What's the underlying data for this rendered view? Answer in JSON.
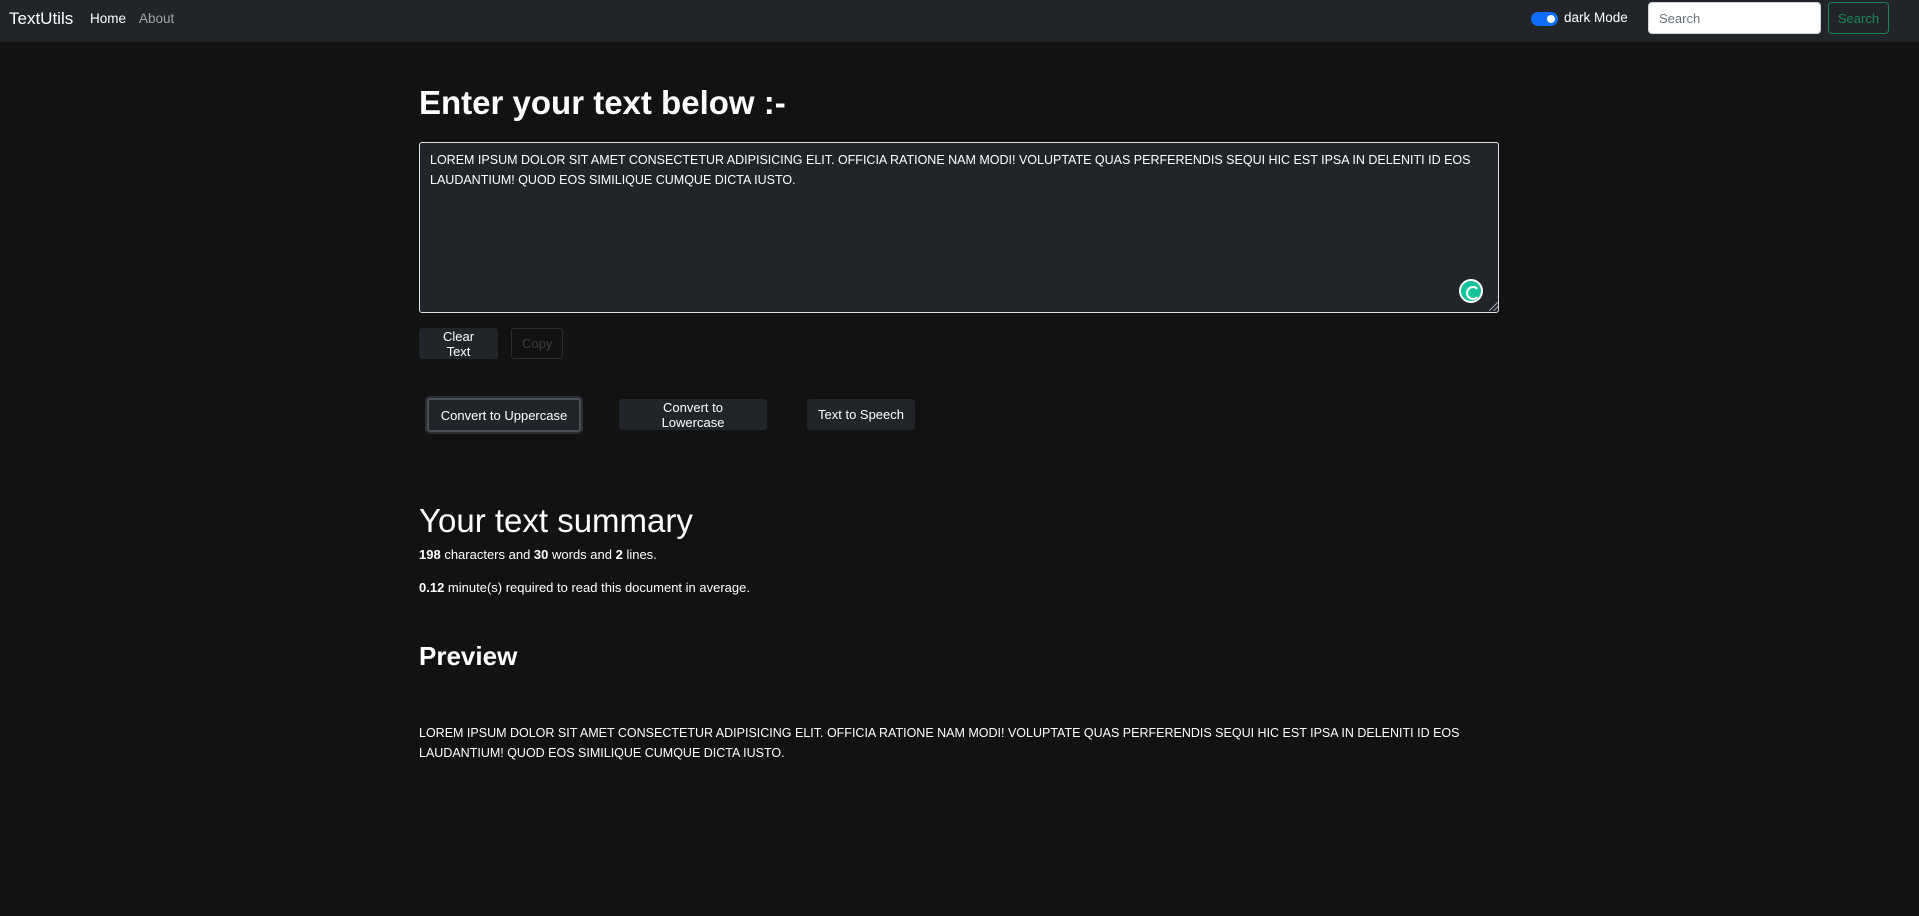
{
  "navbar": {
    "brand": "TextUtils",
    "links": [
      {
        "label": "Home",
        "active": true
      },
      {
        "label": "About",
        "active": false
      }
    ],
    "dark_mode_label": "dark Mode",
    "dark_mode_on": true,
    "search_placeholder": "Search",
    "search_button": "Search"
  },
  "main": {
    "heading": "Enter your text below :-",
    "textarea_value": "LOREM IPSUM DOLOR SIT AMET CONSECTETUR ADIPISICING ELIT. OFFICIA RATIONE NAM MODI! VOLUPTATE QUAS PERFERENDIS SEQUI HIC EST IPSA IN DELENITI ID EOS LAUDANTIUM! QUOD EOS SIMILIQUE CUMQUE DICTA IUSTO.",
    "buttons": {
      "clear": "Clear Text",
      "copy": "Copy",
      "uppercase": "Convert to Uppercase",
      "lowercase": "Convert to Lowercase",
      "speech": "Text to Speech"
    }
  },
  "summary": {
    "heading": "Your text summary",
    "characters": "198",
    "characters_label": " characters and ",
    "words": "30",
    "words_label": " words and ",
    "lines": "2",
    "lines_label": " lines.",
    "minutes": "0.12",
    "minutes_label": " minute(s) required to read this document in average."
  },
  "preview": {
    "heading": "Preview",
    "text": "LOREM IPSUM DOLOR SIT AMET CONSECTETUR ADIPISICING ELIT. OFFICIA RATIONE NAM MODI! VOLUPTATE QUAS PERFERENDIS SEQUI HIC EST IPSA IN DELENITI ID EOS LAUDANTIUM! QUOD EOS SIMILIQUE CUMQUE DICTA IUSTO."
  },
  "colors": {
    "page_bg": "#121212",
    "navbar_bg": "#212529",
    "toggle_accent": "#0d6efd",
    "search_accent": "#198754",
    "grammarly": "#15c39a"
  }
}
